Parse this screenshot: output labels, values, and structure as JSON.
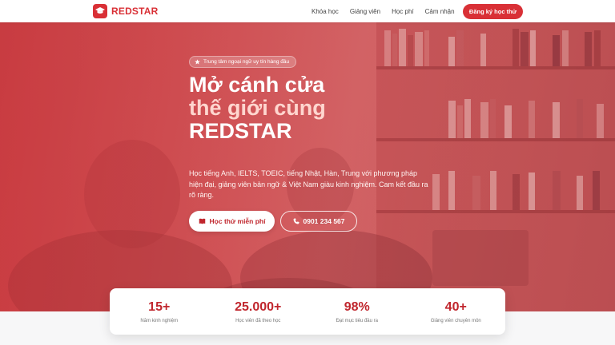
{
  "brand": {
    "name": "REDSTAR",
    "accent": "#d93036",
    "logo_icon": "graduation-cap-icon"
  },
  "nav": {
    "items": [
      "Khóa học",
      "Giảng viên",
      "Học phí",
      "Cảm nhận"
    ],
    "cta": "Đăng ký học thử"
  },
  "hero": {
    "badge_icon": "star-icon",
    "badge": "Trung tâm ngoại ngữ uy tín hàng đầu",
    "headline_1": "Mở cánh cửa",
    "headline_2": "thế giới cùng",
    "headline_3": "REDSTAR",
    "description": "Học tiếng Anh, IELTS, TOEIC, tiếng Nhật, Hàn, Trung với phương pháp hiện đại, giảng viên bản ngữ & Việt Nam giàu kinh nghiệm. Cam kết đầu ra rõ ràng.",
    "primary_button": "Học thử miễn phí",
    "primary_icon": "book-icon",
    "secondary_button": "0901 234 567",
    "secondary_icon": "phone-icon"
  },
  "stats": [
    {
      "value": "15+",
      "label": "Năm kinh nghiệm"
    },
    {
      "value": "25.000+",
      "label": "Học viên đã theo học"
    },
    {
      "value": "98%",
      "label": "Đạt mục tiêu đầu ra"
    },
    {
      "value": "40+",
      "label": "Giảng viên chuyên môn"
    }
  ]
}
